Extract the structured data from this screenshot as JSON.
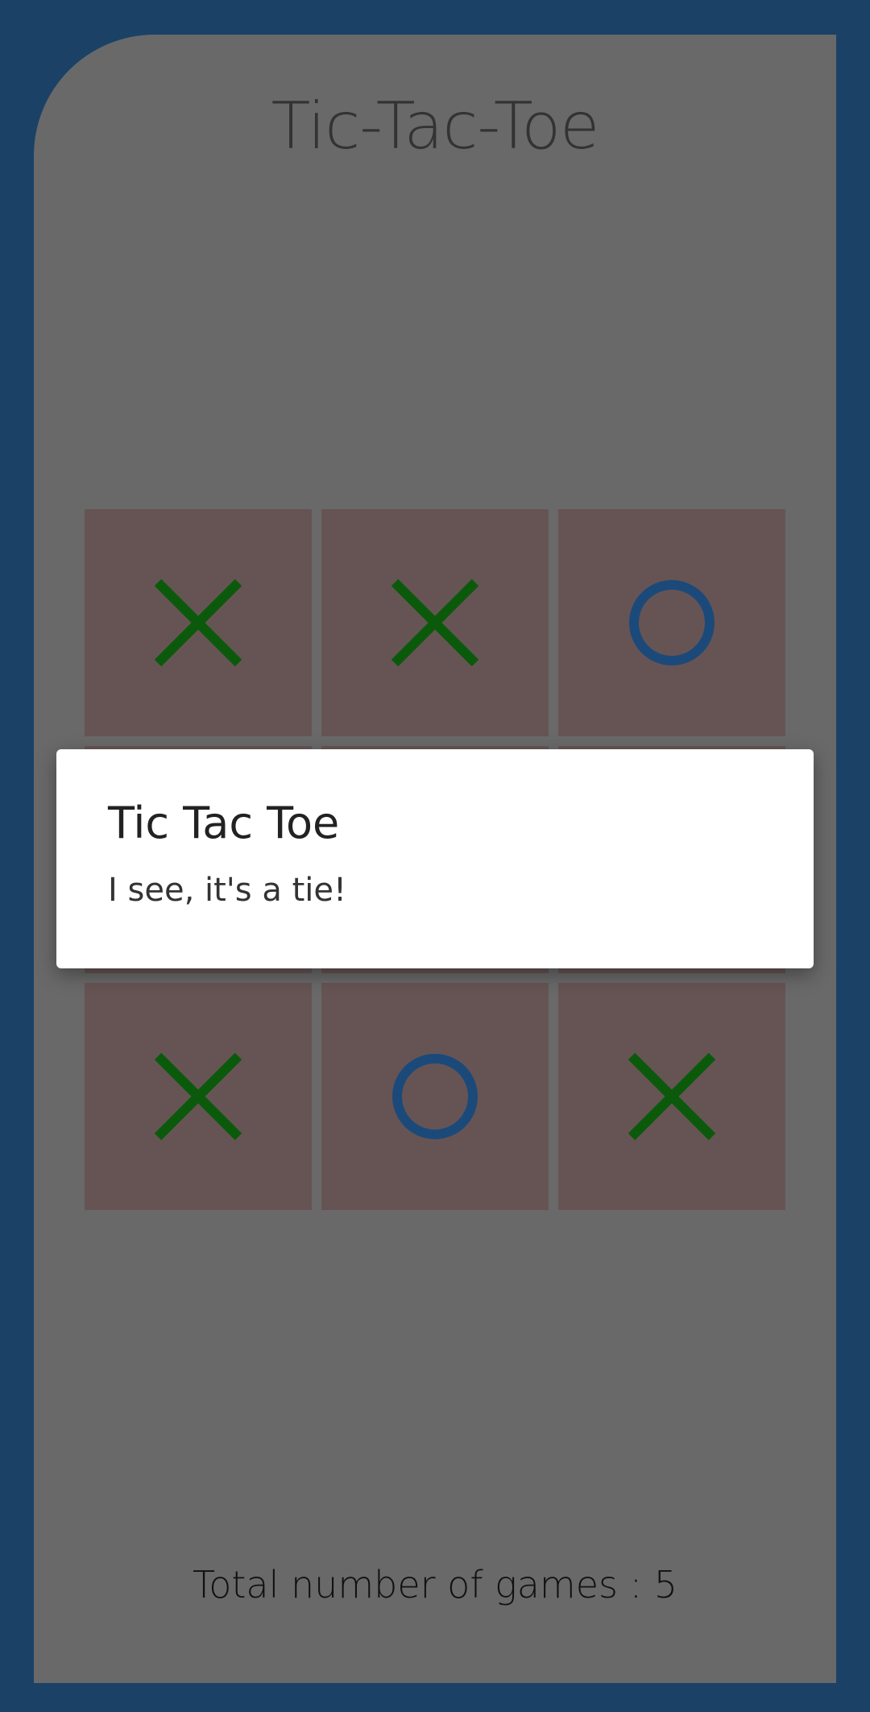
{
  "app": {
    "title": "Tic-Tac-Toe",
    "footer_text": "Total number of games : 5"
  },
  "board": {
    "cells": [
      "X",
      "X",
      "O",
      "",
      "",
      "",
      "X",
      "O",
      "X"
    ],
    "colors": {
      "x": "#0b5a0b",
      "o": "#1b4a7a"
    }
  },
  "dialog": {
    "title": "Tic Tac Toe",
    "message": "I see, it's a tie!"
  },
  "colors": {
    "frame": "#1b4266",
    "panel": "#696969",
    "cell": "#665454"
  }
}
